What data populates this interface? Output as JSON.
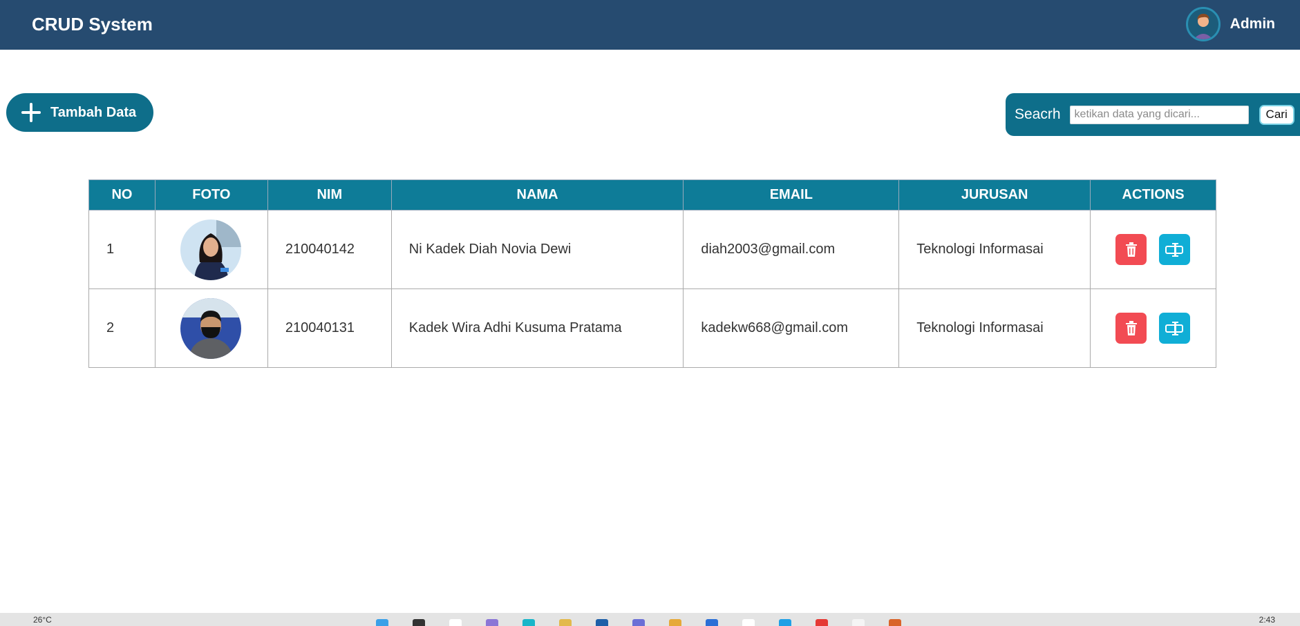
{
  "app": {
    "title": "CRUD System",
    "user_name": "Admin"
  },
  "toolbar": {
    "add_label": "Tambah Data"
  },
  "search": {
    "label": "Seacrh",
    "placeholder": "ketikan data yang dicari...",
    "button_label": "Cari"
  },
  "table": {
    "headers": [
      "NO",
      "FOTO",
      "NIM",
      "NAMA",
      "EMAIL",
      "JURUSAN",
      "ACTIONS"
    ],
    "rows": [
      {
        "no": "1",
        "nim": "210040142",
        "nama": "Ni Kadek Diah Novia Dewi",
        "email": "diah2003@gmail.com",
        "jurusan": "Teknologi Informasai"
      },
      {
        "no": "2",
        "nim": "210040131",
        "nama": "Kadek Wira Adhi Kusuma Pratama",
        "email": "kadekw668@gmail.com",
        "jurusan": "Teknologi Informasai"
      }
    ]
  },
  "taskbar": {
    "weather": "26°C",
    "time": "2:43"
  },
  "colors": {
    "header": "#264b70",
    "accent": "#0e7c98",
    "delete": "#f24b53",
    "edit": "#10aed6"
  }
}
